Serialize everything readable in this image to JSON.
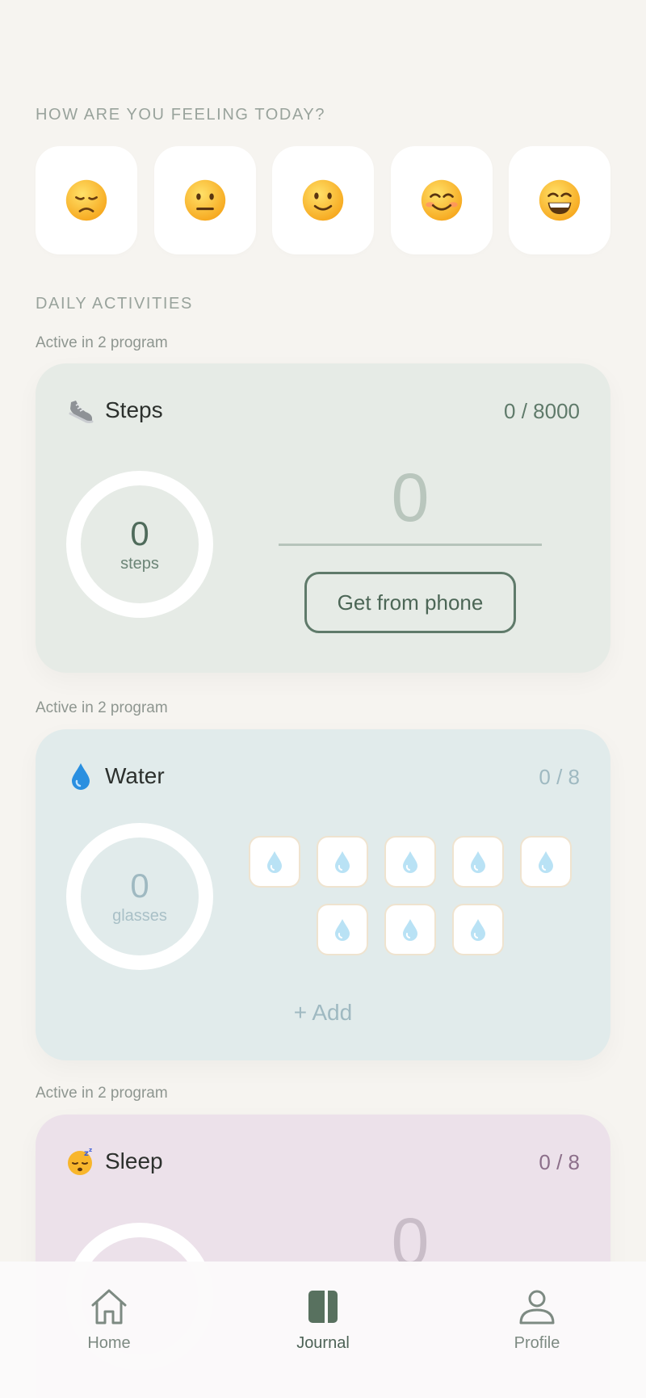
{
  "mood": {
    "title": "HOW ARE YOU FEELING TODAY?",
    "options": [
      {
        "name": "disappointed-face"
      },
      {
        "name": "neutral-face"
      },
      {
        "name": "slightly-smiling-face"
      },
      {
        "name": "smiling-face"
      },
      {
        "name": "grinning-face"
      }
    ]
  },
  "activities": {
    "title": "DAILY ACTIVITIES",
    "steps": {
      "program_note": "Active in 2 program",
      "icon": "shoe-icon",
      "title": "Steps",
      "goal": "0 / 8000",
      "count": "0",
      "unit": "steps",
      "input_value": "0",
      "button_label": "Get from phone",
      "accent": "#5f7a6a"
    },
    "water": {
      "program_note": "Active in 2 program",
      "icon": "droplet-icon",
      "title": "Water",
      "goal": "0 / 8",
      "count": "0",
      "unit": "glasses",
      "glasses_filled": 0,
      "glasses_total": 8,
      "add_label": "+ Add",
      "accent": "#9fb9c1"
    },
    "sleep": {
      "program_note": "Active in 2 program",
      "icon": "sleeping-face-icon",
      "title": "Sleep",
      "goal": "0 / 8",
      "input_value": "0",
      "accent": "#8c6f8a"
    }
  },
  "tabbar": {
    "items": [
      {
        "label": "Home",
        "icon": "home-icon",
        "active": false
      },
      {
        "label": "Journal",
        "icon": "journal-icon",
        "active": true
      },
      {
        "label": "Profile",
        "icon": "person-icon",
        "active": false
      }
    ]
  }
}
